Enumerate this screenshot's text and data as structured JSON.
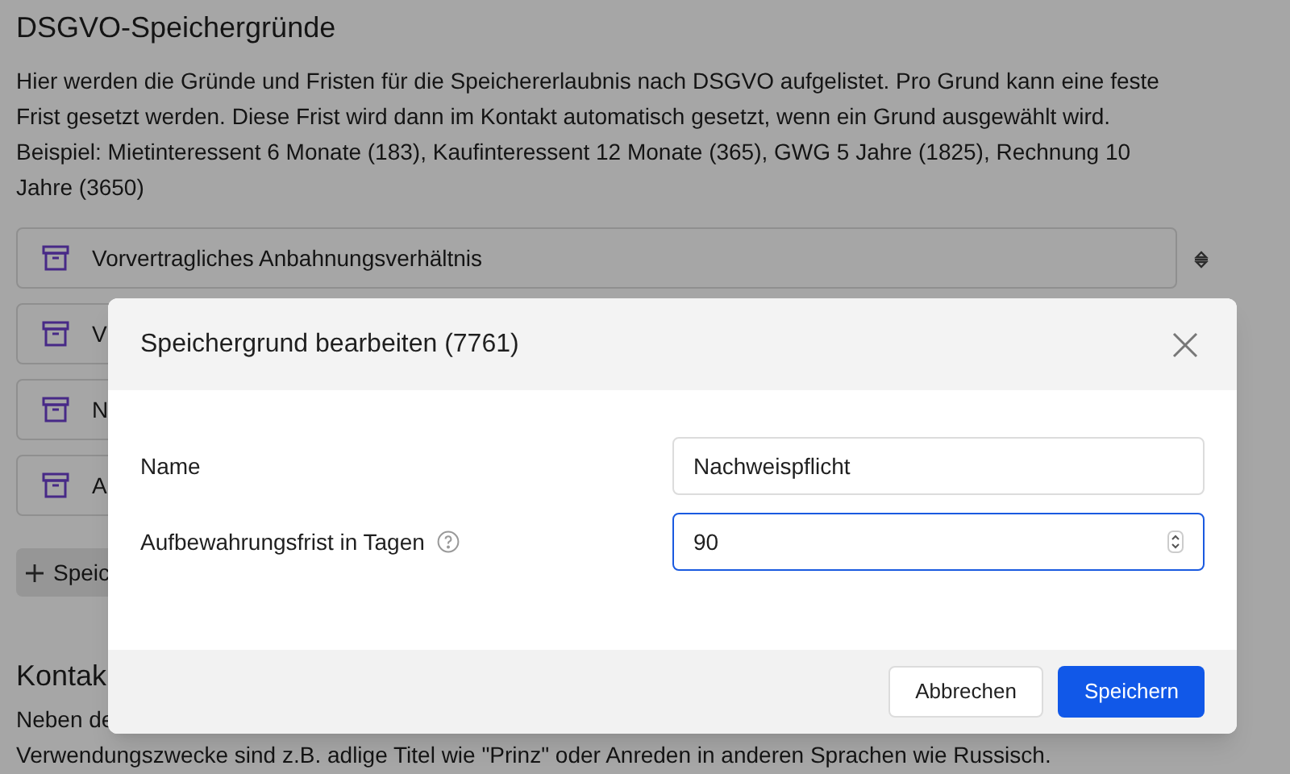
{
  "page": {
    "title": "DSGVO-Speichergründe",
    "description": "Hier werden die Gründe und Fristen für die Speichererlaubnis nach DSGVO aufgelistet. Pro Grund kann eine feste Frist gesetzt werden. Diese Frist wird dann im Kontakt automatisch gesetzt, wenn ein Grund ausgewählt wird. Beispiel: Mietinteressent 6 Monate (183), Kaufinteressent 12 Monate (365), GWG 5 Jahre (1825), Rechnung 10 Jahre (3650)",
    "reasons": [
      {
        "label": "Vorvertragliches Anbahnungsverhältnis"
      },
      {
        "label": "V"
      },
      {
        "label": "N"
      },
      {
        "label": "A"
      }
    ],
    "add_button": "Speic",
    "section_title": "Kontak",
    "section_lines": [
      "Neben de",
      "Verwendungszwecke sind z.B. adlige Titel wie \"Prinz\" oder Anreden in anderen Sprachen wie Russisch."
    ]
  },
  "dialog": {
    "title": "Speichergrund bearbeiten (7761)",
    "fields": [
      {
        "label": "Name",
        "value": "Nachweispflicht",
        "focused": false,
        "kind": "text",
        "help": false
      },
      {
        "label": "Aufbewahrungsfrist in Tagen",
        "value": "90",
        "focused": true,
        "kind": "number",
        "help": true
      }
    ],
    "buttons": [
      {
        "label": "Abbrechen",
        "kind": "secondary"
      },
      {
        "label": "Speichern",
        "kind": "primary"
      }
    ]
  }
}
